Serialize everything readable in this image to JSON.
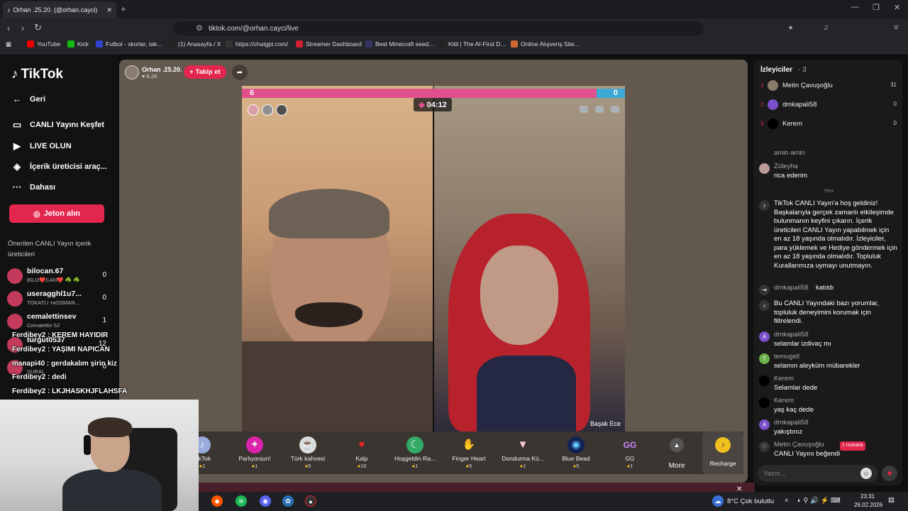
{
  "browser": {
    "tab_title": "Orhan .25.20. (@orhan.cayci)",
    "url": "tiktok.com/@orhan.cayci/live",
    "bookmarks": [
      {
        "label": "YouTube",
        "color": "#e00"
      },
      {
        "label": "Kick",
        "color": "#1b1"
      },
      {
        "label": "Futbol - skorlar, tak...",
        "color": "#34c"
      },
      {
        "label": "(1) Anasayfa / X",
        "color": "#222"
      },
      {
        "label": "https://chatgpt.com/",
        "color": "#333"
      },
      {
        "label": "Streamer Dashboard",
        "color": "#c23"
      },
      {
        "label": "Best Minecraft seed...",
        "color": "#336"
      },
      {
        "label": "Kittl | The AI-First D...",
        "color": "#222"
      },
      {
        "label": "Online Alışveriş Site...",
        "color": "#c63"
      }
    ]
  },
  "sidebar": {
    "logo": "TikTok",
    "back": "Geri",
    "items": [
      {
        "label": "CANLI Yayını Keşfet",
        "icon": "tv-icon"
      },
      {
        "label": "LIVE OLUN",
        "icon": "camera-icon"
      },
      {
        "label": "İçerik üreticisi araç...",
        "icon": "lightbulb-icon"
      },
      {
        "label": "Dahası",
        "icon": "more-icon"
      }
    ],
    "coins_button": "Jeton alın",
    "suggested_title": "Önerilen CANLI Yayın içerik üreticileri",
    "suggested": [
      {
        "name": "bilocan.67",
        "sub": "BİLO❤️CAN❤️ ☘️ ☘️",
        "count": "0"
      },
      {
        "name": "useragghl1u7...",
        "sub": "TOKATLI ᴛʀOSMAN...",
        "count": "0"
      },
      {
        "name": "cemalettinsev",
        "sub": "Cemalettin 52",
        "count": "1"
      },
      {
        "name": "turgut0537",
        "sub": "",
        "count": "12"
      },
      {
        "name": "",
        "sub": "VURAL",
        "count": "0"
      }
    ]
  },
  "stream": {
    "host_name": "Orhan .25.20.",
    "host_likes": "8.2K",
    "follow_label": "+ Takip et",
    "score_left": "6",
    "score_right": "0",
    "timer": "04:12",
    "guest_name": "Başak Ece"
  },
  "gifts": [
    {
      "name": "TikTok",
      "price": "1",
      "icon": "tiktok-gift-icon"
    },
    {
      "name": "Parlıyorsun!",
      "price": "1",
      "icon": "sparkle-gift-icon"
    },
    {
      "name": "Türk kahvesi",
      "price": "5",
      "icon": "coffee-gift-icon"
    },
    {
      "name": "Kalp",
      "price": "10",
      "icon": "heart-gift-icon"
    },
    {
      "name": "Hoşgeldin Ra...",
      "price": "1",
      "icon": "ramadan-gift-icon"
    },
    {
      "name": "Finger Heart",
      "price": "5",
      "icon": "finger-heart-gift-icon"
    },
    {
      "name": "Dondurma Kü...",
      "price": "1",
      "icon": "icecream-gift-icon"
    },
    {
      "name": "Blue Bead",
      "price": "5",
      "icon": "evil-eye-gift-icon"
    },
    {
      "name": "GG",
      "price": "1",
      "icon": "gg-gift-icon"
    }
  ],
  "more_label": "More",
  "recharge_label": "Recharge",
  "viewers": {
    "title": "İzleyiciler",
    "count": "· 3",
    "list": [
      {
        "rank": "1",
        "name": "Metin Çavuşoğlu",
        "value": "31"
      },
      {
        "rank": "2",
        "name": "dmkapali58",
        "value": "0"
      },
      {
        "rank": "3",
        "name": "Kerem",
        "value": "0"
      }
    ]
  },
  "chat": {
    "old_messages": [
      {
        "user": "amin amin",
        "text": ""
      },
      {
        "user": "Züleyha",
        "text": "rica ederim"
      }
    ],
    "new_label": "Yeni",
    "welcome": "TikTok CANLI Yayın'a hoş geldiniz! Başkalarıyla gerçek zamanlı etkileşimde bulunmanın keyfini çıkarın. İçerik üreticileri CANLI Yayın yapabilmek için en az 18 yaşında olmalıdır. İzleyiciler, para yüklemek ve Hediye göndermek için en az 18 yaşında olmalıdır. Topluluk Kurallarımıza uymayı unutmayın.",
    "joined": {
      "user": "dmkapali58",
      "text": "katıldı"
    },
    "filter_notice": "Bu CANLI Yayındaki bazı yorumlar, topluluk deneyimini korumak için filtrelendi.",
    "messages": [
      {
        "user": "dmkapali58",
        "text": "selamlar izdivaç mı"
      },
      {
        "user": "temugell",
        "text": "selamın aleyküm mübarekler"
      },
      {
        "user": "Kerem",
        "text": "Selamlar dede"
      },
      {
        "user": "Kerem",
        "text": "yaş kaç dede"
      },
      {
        "user": "dmkapali58",
        "text": "yakıştınız"
      },
      {
        "user": "Metin Çavuşoğlu",
        "badge": "1 numara",
        "text": "CANLI Yayını beğendi"
      }
    ],
    "input_placeholder": "Yazın..."
  },
  "overlay_chat": [
    "Ferdibey2 : KEREM HAYIDIR",
    "Ferdibey2 : YAŞIMI NAPICAN",
    "manapi40 : gerdakalım şirin kiz",
    "Ferdibey2 : dedi",
    "Ferdibey2 : LKJHASKHJFLAHSFA"
  ],
  "taskbar": {
    "weather": "8°C  Çok bulutlu",
    "time": "23:31",
    "date": "26.02.2026"
  }
}
